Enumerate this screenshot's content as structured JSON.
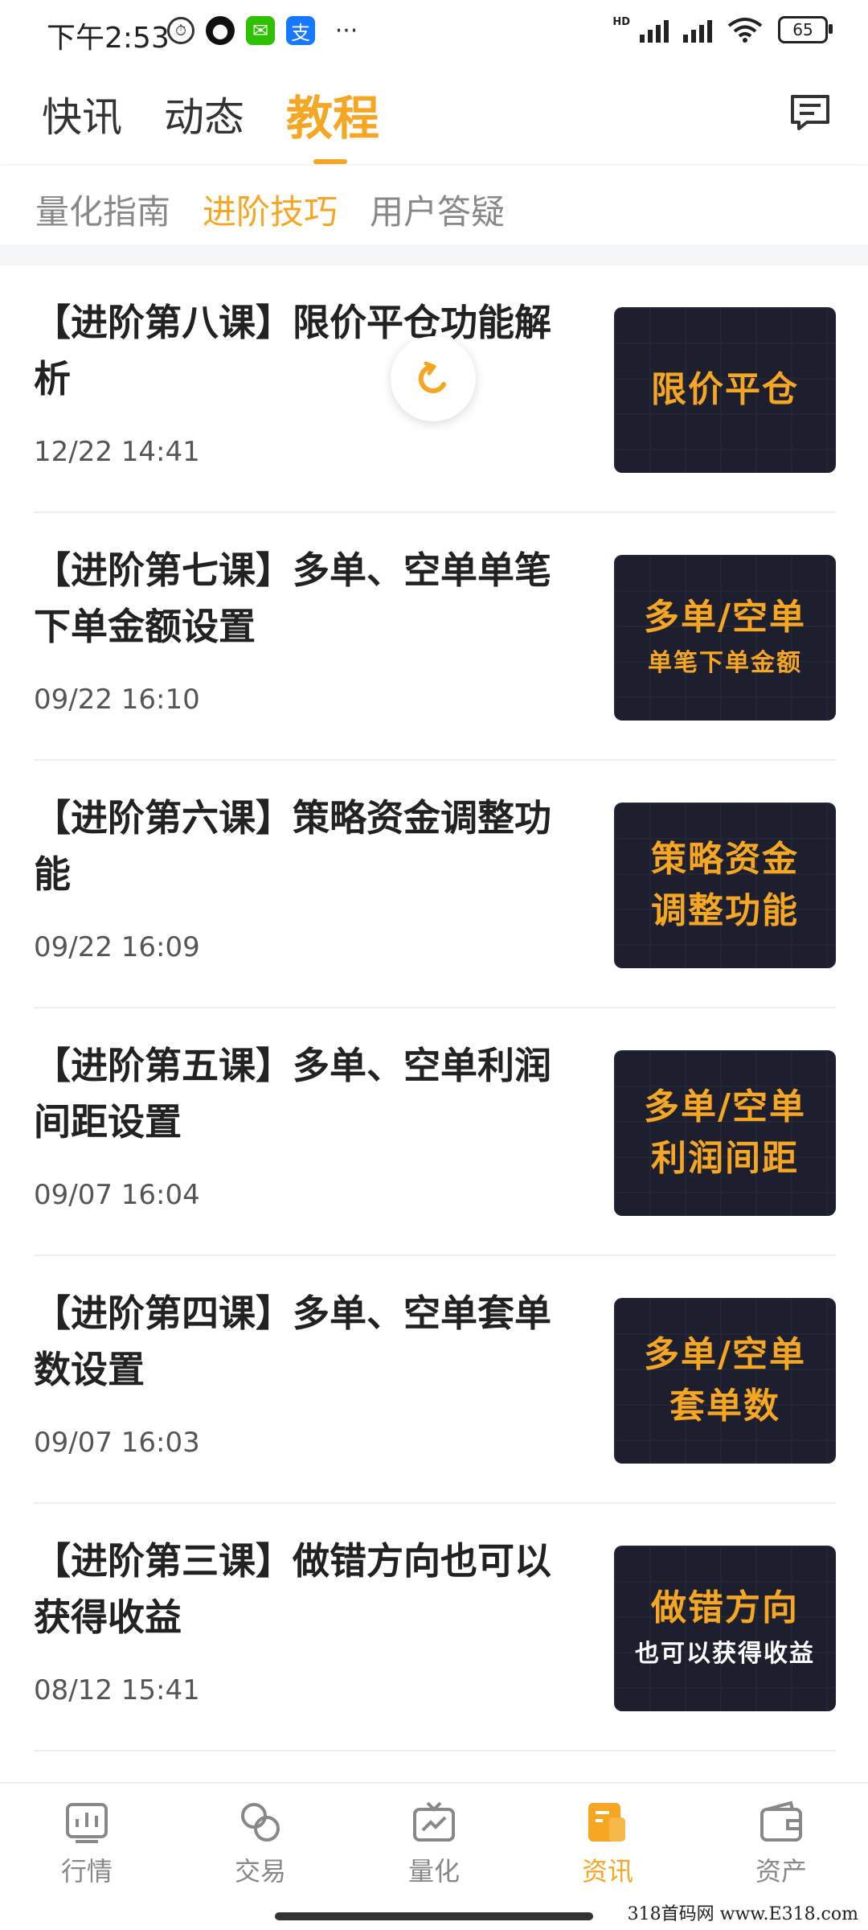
{
  "status_bar": {
    "time": "下午2:53",
    "battery": "65",
    "hd": "HD"
  },
  "top_tabs": [
    "快讯",
    "动态",
    "教程"
  ],
  "sub_tabs": [
    "量化指南",
    "进阶技巧",
    "用户答疑"
  ],
  "articles": [
    {
      "title": "【进阶第八课】限价平仓功能解析",
      "date": "12/22 14:41",
      "thumb_line1": "限价平仓",
      "thumb_line2": ""
    },
    {
      "title": "【进阶第七课】多单、空单单笔下单金额设置",
      "date": "09/22 16:10",
      "thumb_line1": "多单/空单",
      "thumb_line2": "单笔下单金额"
    },
    {
      "title": "【进阶第六课】策略资金调整功能",
      "date": "09/22 16:09",
      "thumb_line1": "策略资金",
      "thumb_line2": "调整功能"
    },
    {
      "title": "【进阶第五课】多单、空单利润间距设置",
      "date": "09/07 16:04",
      "thumb_line1": "多单/空单",
      "thumb_line2": "利润间距"
    },
    {
      "title": "【进阶第四课】多单、空单套单数设置",
      "date": "09/07 16:03",
      "thumb_line1": "多单/空单",
      "thumb_line2": "套单数"
    },
    {
      "title": "【进阶第三课】做错方向也可以获得收益",
      "date": "08/12 15:41",
      "thumb_line1": "做错方向",
      "thumb_line2": "也可以获得收益"
    }
  ],
  "bottom_nav": [
    "行情",
    "交易",
    "量化",
    "资讯",
    "资产"
  ],
  "watermark": "318首码网 www.E318.com",
  "colors": {
    "accent": "#f5a623",
    "thumb_bg": "#1d1f2e"
  }
}
